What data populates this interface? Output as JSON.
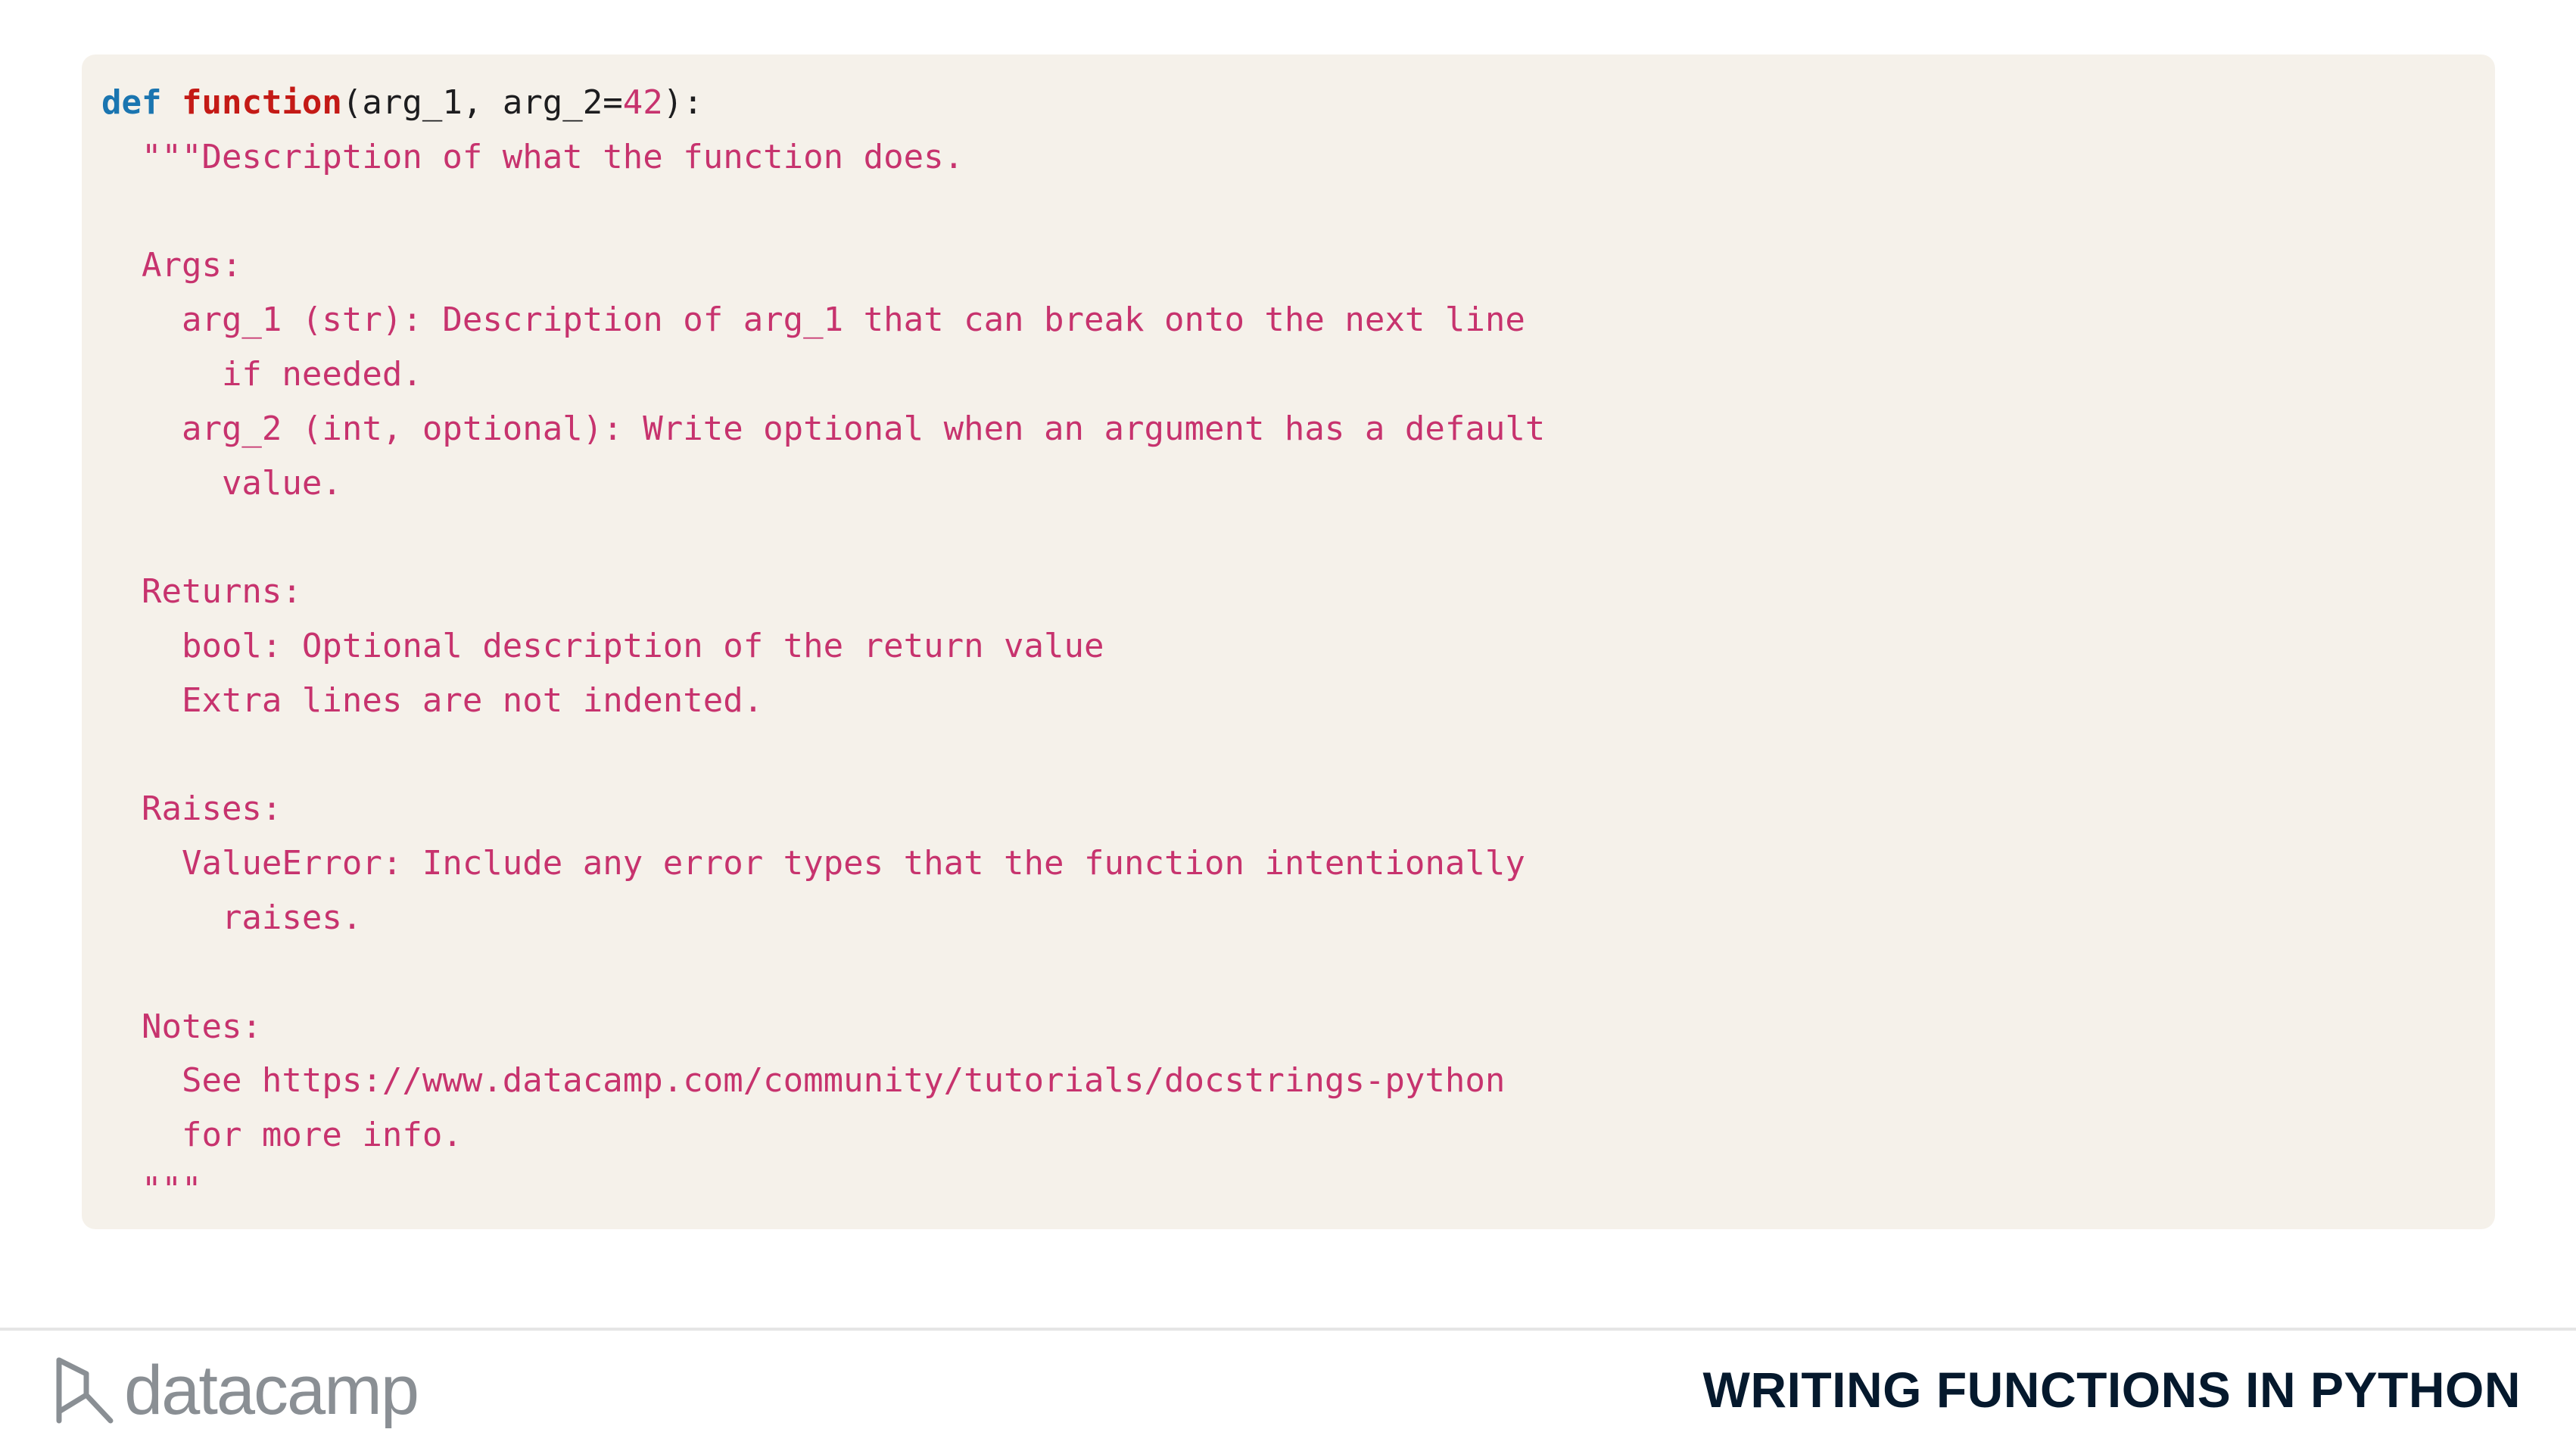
{
  "code": {
    "line1": {
      "kw": "def",
      "fn": "function",
      "params_a": "(arg_1, arg_2=",
      "default_value": "42",
      "params_b": "):"
    },
    "doc_lines": [
      "  \"\"\"Description of what the function does.",
      "",
      "  Args:",
      "    arg_1 (str): Description of arg_1 that can break onto the next line",
      "      if needed.",
      "    arg_2 (int, optional): Write optional when an argument has a default",
      "      value.",
      "",
      "  Returns:",
      "    bool: Optional description of the return value",
      "    Extra lines are not indented.",
      "",
      "  Raises:",
      "    ValueError: Include any error types that the function intentionally",
      "      raises.",
      "",
      "  Notes:",
      "    See https://www.datacamp.com/community/tutorials/docstrings-python",
      "    for more info.",
      "  \"\"\""
    ]
  },
  "footer": {
    "logo_text": "datacamp",
    "logo_icon": "datacamp-logo-icon",
    "course_title": "WRITING FUNCTIONS IN PYTHON"
  },
  "colors": {
    "code_background": "#f5f1ea",
    "keyword": "#1a75b0",
    "function_name": "#c41a16",
    "docstring": "#c7336e",
    "plain_text": "#1d1d1f",
    "footer_title": "#05192d",
    "logo": "#8a8f94"
  }
}
